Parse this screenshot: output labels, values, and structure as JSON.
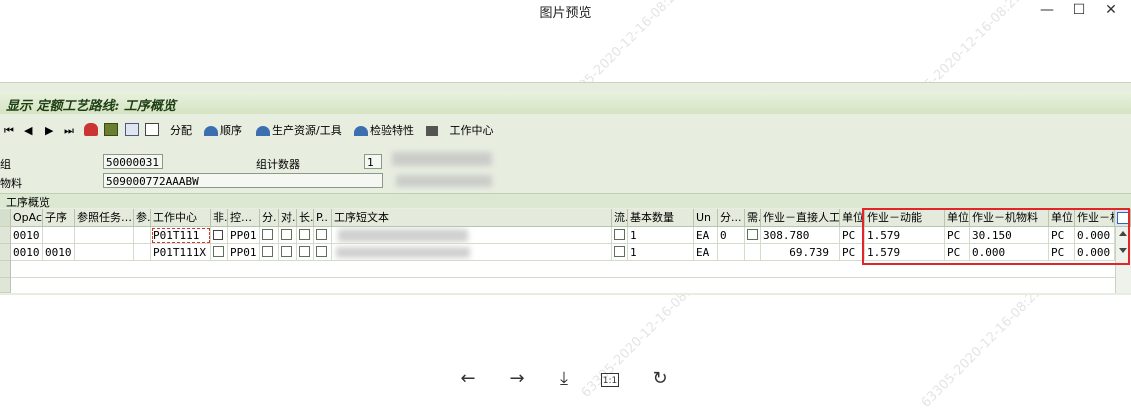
{
  "window": {
    "title": "图片预览",
    "minimize_glyph": "—",
    "maximize_glyph": "☐",
    "close_glyph": "✕"
  },
  "sap": {
    "title": "显示 定额工艺路线: 工序概览",
    "toolbar": {
      "first_glyph": "⏮",
      "prev_glyph": "◀",
      "next_glyph": "▶",
      "last_glyph": "⏭",
      "allocate": "分配",
      "sequence": "顺序",
      "prt": "生产资源/工具",
      "inspection": "检验特性",
      "workcenter": "工作中心"
    },
    "header": {
      "group_label": "组",
      "group_value": "50000031",
      "counter_label": "组计数器",
      "counter_value": "1",
      "material_label": "物料",
      "material_value": "509000772AAABW"
    },
    "section_title": "工序概览",
    "table": {
      "columns": [
        "OpAc",
        "子序",
        "参照任务…",
        "参.",
        "工作中心",
        "非.",
        "控…",
        "分.",
        "对.",
        "长.",
        "P..",
        "工序短文本",
        "流.",
        "基本数量",
        "Un",
        "分...",
        "需.",
        "作业－直接人工",
        "单位",
        "作业－动能",
        "单位",
        "作业－机物料",
        "单位",
        "作业－机"
      ],
      "rows": [
        {
          "opac": "0010",
          "sub": "",
          "workcenter": "P01T111",
          "control": "PP01",
          "qty": "1",
          "unit": "EA",
          "split": "0",
          "labor": "308.780",
          "labor_unit": "PC",
          "energy": "1.579",
          "energy_unit": "PC",
          "material": "30.150",
          "material_unit": "PC",
          "machine": "0.000"
        },
        {
          "opac": "0010",
          "sub": "0010",
          "workcenter": "P01T111X",
          "control": "PP01",
          "qty": "1",
          "unit": "EA",
          "split": "",
          "labor": "69.739",
          "labor_unit": "PC",
          "energy": "1.579",
          "energy_unit": "PC",
          "material": "0.000",
          "material_unit": "PC",
          "machine": "0.000"
        }
      ]
    }
  },
  "viewer": {
    "back_glyph": "←",
    "forward_glyph": "→",
    "download_glyph": "⤓",
    "actual_size": "1:1",
    "rotate_glyph": "↻"
  },
  "watermark": "63305-2020-12-16-08:23",
  "colors": {
    "highlight_border": "#e0252b",
    "sap_title_text": "#1c3e12",
    "sap_background": "#e7eee0"
  }
}
